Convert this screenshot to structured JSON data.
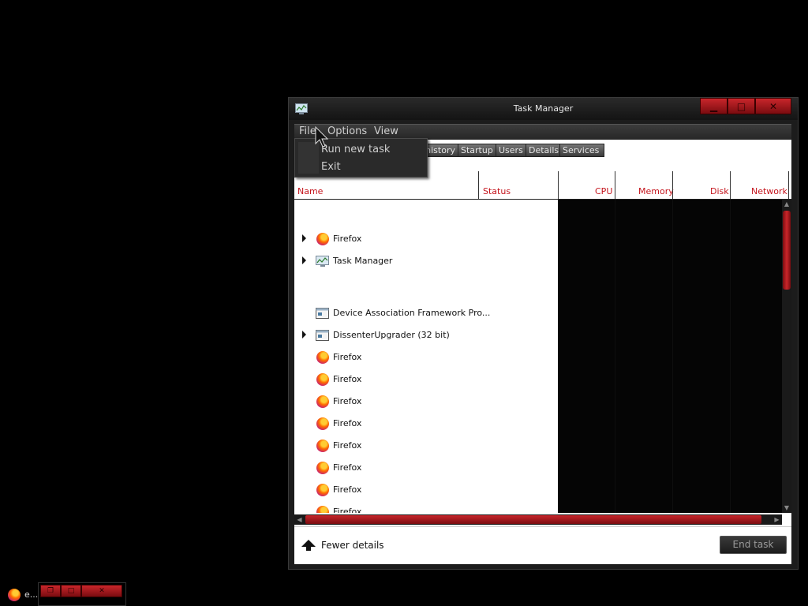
{
  "window": {
    "title": "Task Manager"
  },
  "caption_buttons": {
    "minimize": "▁",
    "maximize": "□",
    "close": "✕"
  },
  "menu": {
    "items": [
      "File",
      "Options",
      "View"
    ]
  },
  "file_menu": {
    "items": [
      "Run new task",
      "Exit"
    ]
  },
  "tabs": [
    "history",
    "Startup",
    "Users",
    "Details",
    "Services"
  ],
  "columns": {
    "name": "Name",
    "status": "Status",
    "cpu": "CPU",
    "memory": "Memory",
    "disk": "Disk",
    "network": "Network"
  },
  "processes": [
    {
      "name": "Firefox",
      "icon": "firefox-icon",
      "expandable": true
    },
    {
      "name": "Task Manager",
      "icon": "task-manager-icon",
      "expandable": true
    },
    {
      "name": "Device Association Framework Pro...",
      "icon": "service-window-icon",
      "expandable": false
    },
    {
      "name": "DissenterUpgrader (32 bit)",
      "icon": "service-window-icon",
      "expandable": true
    },
    {
      "name": "Firefox",
      "icon": "firefox-icon",
      "expandable": false
    },
    {
      "name": "Firefox",
      "icon": "firefox-icon",
      "expandable": false
    },
    {
      "name": "Firefox",
      "icon": "firefox-icon",
      "expandable": false
    },
    {
      "name": "Firefox",
      "icon": "firefox-icon",
      "expandable": false
    },
    {
      "name": "Firefox",
      "icon": "firefox-icon",
      "expandable": false
    },
    {
      "name": "Firefox",
      "icon": "firefox-icon",
      "expandable": false
    },
    {
      "name": "Firefox",
      "icon": "firefox-icon",
      "expandable": false
    },
    {
      "name": "Firefox",
      "icon": "firefox-icon",
      "expandable": false
    }
  ],
  "footer": {
    "fewer_details": "Fewer details",
    "end_task": "End task"
  },
  "taskbar": {
    "label": "e..."
  },
  "colors": {
    "accent": "#c9262b",
    "header_text": "#c4141c",
    "background": "#000000"
  }
}
